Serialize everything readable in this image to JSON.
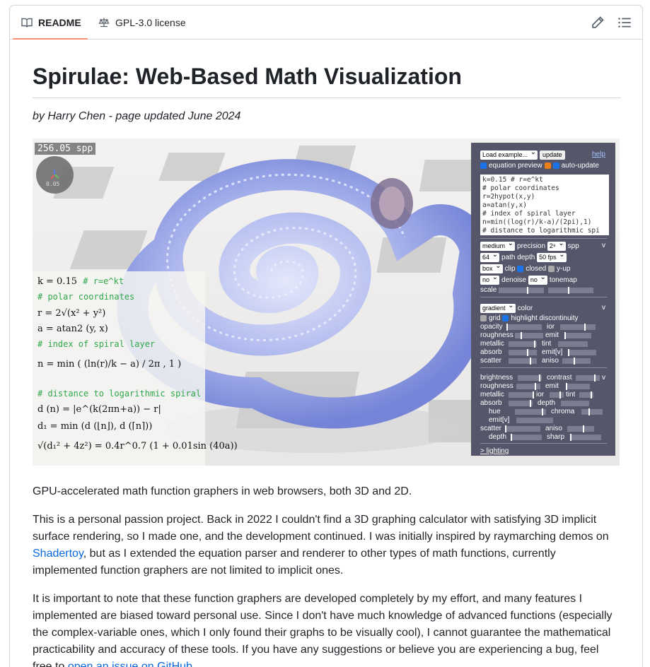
{
  "tabs": {
    "readme": "README",
    "license": "GPL-3.0 license",
    "edit_icon": "pencil-icon",
    "outline_icon": "list-unordered-icon"
  },
  "title": "Spirulae: Web-Based Math Visualization",
  "byline": "by Harry Chen - page updated June 2024",
  "hero": {
    "spp": "256.05 spp",
    "gizmo_value": "0.05",
    "equations": {
      "k": "k = 0.15",
      "k_comment": "# r=e^kt",
      "c1": "# polar coordinates",
      "r": "r = 2√(x² + y²)",
      "a": "a = atan2 (y, x)",
      "c2": "# index of spiral layer",
      "n": "n = min ( (ln(r)/k − a) / 2π , 1 )",
      "c3": "# distance to logarithmic spiral",
      "d": "d (n) = |e^(k(2πn+a)) − r|",
      "d1": "d₁ = min (d (⌊n⌋), d (⌈n⌉))",
      "last": "√(d₁² + 4z²) = 0.4r^0.7 (1 + 0.01sin (40a))"
    },
    "panel": {
      "load_example": "Load example...",
      "update": "update",
      "help": "help",
      "equation_preview": "equation preview",
      "auto_update": "auto-update",
      "code": [
        "k=0.15 # r=e^kt",
        "# polar coordinates",
        "r=2hypot(x,y)",
        "a=atan(y,x)",
        "# index of spiral layer",
        "n=min((log(r)/k-a)/(2pi),1)",
        "# distance to logarithmic spi"
      ],
      "precision_value": "medium",
      "precision": "precision",
      "spp_value": "2⁸",
      "spp": "spp",
      "v": "v",
      "path_depth_value": "64",
      "path_depth": "path depth",
      "fps_value": "50 fps",
      "clip_value": "box",
      "clip": "clip",
      "closed": "closed",
      "y_up": "y-up",
      "denoise_value": "no",
      "denoise": "denoise",
      "tonemap_value": "no",
      "tonemap": "tonemap",
      "scale": "scale",
      "color_value": "gradient",
      "color": "color",
      "grid": "grid",
      "highlight": "highlight discontinuity",
      "opacity": "opacity",
      "ior": "ior",
      "roughness": "roughness",
      "emit": "emit",
      "metallic": "metallic",
      "tint": "tint",
      "absorb": "absorb",
      "emit_v": "emit[v]",
      "scatter": "scatter",
      "aniso": "aniso",
      "brightness": "brightness",
      "contrast": "contrast",
      "depth": "depth",
      "hue": "hue",
      "chroma": "chroma",
      "sharp": "sharp",
      "lighting": "> lighting"
    }
  },
  "body": {
    "p1": "GPU-accelerated math function graphers in web browsers, both 3D and 2D.",
    "p2_a": "This is a personal passion project. Back in 2022 I couldn't find a 3D graphing calculator with satisfying 3D implicit surface rendering, so I made one, and the development continued. I was initially inspired by raymarching demos on ",
    "p2_link": "Shadertoy",
    "p2_b": ", but as I extended the equation parser and renderer to other types of math functions, currently implemented function graphers are not limited to implicit ones.",
    "p3_a": "It is important to note that these function graphers are developed completely by my effort, and many features I implemented are biased toward personal use. Since I don't have much knowledge of advanced functions (especially the complex-variable ones, which I only found their graphs to be visually cool), I cannot guarantee the mathematical practicability and accuracy of these tools. If you have any suggestions or believe you are experiencing a bug, feel free to ",
    "p3_link": "open an issue on GitHub",
    "p3_b": "."
  },
  "colors": {
    "accent_tab": "#fd8c73",
    "link": "#0969da",
    "comment_green": "#2fa84a",
    "panel_bg": "#55566a"
  }
}
